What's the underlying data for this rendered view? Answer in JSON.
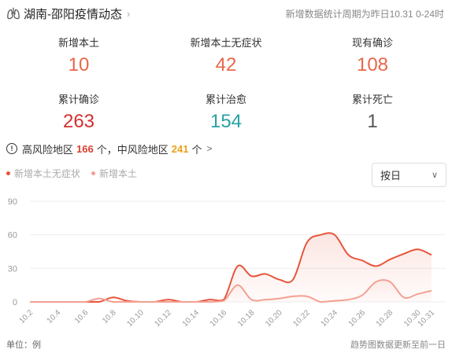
{
  "header": {
    "title": "湖南-邵阳疫情动态",
    "chevron": "›",
    "period": "新增数据统计周期为昨日10.31 0-24时"
  },
  "stats": [
    {
      "label": "新增本土",
      "value": "10",
      "color": "#e8674a"
    },
    {
      "label": "新增本土无症状",
      "value": "42",
      "color": "#e8674a"
    },
    {
      "label": "现有确诊",
      "value": "108",
      "color": "#e8674a"
    },
    {
      "label": "累计确诊",
      "value": "263",
      "color": "#d42f2f"
    },
    {
      "label": "累计治愈",
      "value": "154",
      "color": "#27a3a3"
    },
    {
      "label": "累计死亡",
      "value": "1",
      "color": "#555555"
    }
  ],
  "risk": {
    "icon": "!",
    "high_label": "高风险地区",
    "high_value": "166",
    "high_unit": "个，",
    "mid_label": "中风险地区",
    "mid_value": "241",
    "mid_unit": "个",
    "chevron": ">"
  },
  "select": {
    "value": "按日",
    "caret": "∨"
  },
  "chart_data": {
    "type": "area",
    "ylim": [
      0,
      90
    ],
    "yticks": [
      0,
      30,
      60,
      90
    ],
    "x": [
      "10.2",
      "10.3",
      "10.4",
      "10.5",
      "10.6",
      "10.7",
      "10.8",
      "10.9",
      "10.10",
      "10.11",
      "10.12",
      "10.13",
      "10.14",
      "10.15",
      "10.16",
      "10.17",
      "10.18",
      "10.19",
      "10.20",
      "10.21",
      "10.22",
      "10.23",
      "10.24",
      "10.25",
      "10.26",
      "10.27",
      "10.28",
      "10.29",
      "10.30",
      "10.31"
    ],
    "xtick_labels": [
      "10.2",
      "10.4",
      "10.6",
      "10.8",
      "10.10",
      "10.12",
      "10.14",
      "10.16",
      "10.18",
      "10.20",
      "10.22",
      "10.24",
      "10.26",
      "10.28",
      "10.30",
      "10.31"
    ],
    "series": [
      {
        "name": "新增本土无症状",
        "color": "#e8553c",
        "values": [
          0,
          0,
          0,
          0,
          0,
          0,
          4,
          1,
          0,
          0,
          2,
          0,
          0,
          2,
          2,
          32,
          23,
          25,
          20,
          20,
          53,
          60,
          60,
          42,
          37,
          32,
          38,
          43,
          47,
          42
        ]
      },
      {
        "name": "新增本土",
        "color": "#f4a093",
        "values": [
          0,
          0,
          0,
          0,
          0,
          3,
          0,
          0,
          0,
          0,
          0,
          0,
          0,
          0,
          1,
          15,
          2,
          2,
          3,
          5,
          5,
          0,
          1,
          2,
          6,
          18,
          18,
          4,
          7,
          10
        ]
      }
    ]
  },
  "footer": {
    "unit": "单位：例",
    "note": "趋势图数据更新至前一日"
  }
}
